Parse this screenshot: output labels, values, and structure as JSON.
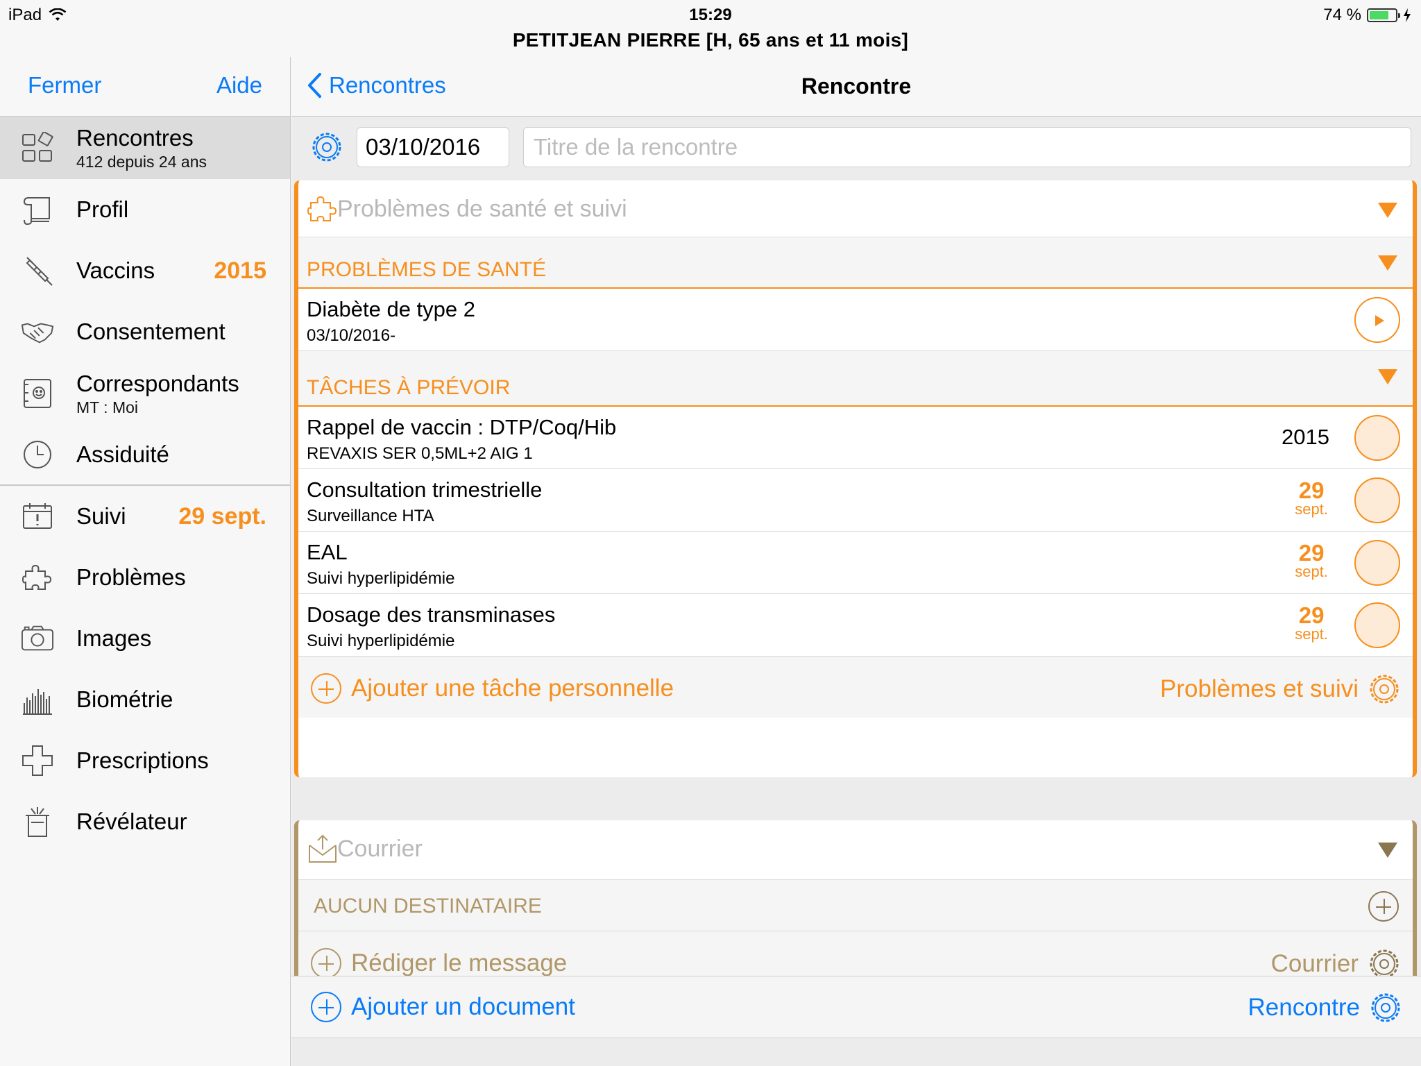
{
  "status": {
    "device": "iPad",
    "time": "15:29",
    "battery": "74 %",
    "battery_level": 0.74
  },
  "patient": "PETITJEAN PIERRE [H, 65 ans et 11 mois]",
  "sidebar": {
    "close": "Fermer",
    "help": "Aide",
    "items": [
      {
        "label": "Rencontres",
        "sub": "412 depuis 24 ans",
        "icon": "grid-icon"
      },
      {
        "label": "Profil",
        "icon": "scroll-icon"
      },
      {
        "label": "Vaccins",
        "badge": "2015",
        "icon": "syringe-icon"
      },
      {
        "label": "Consentement",
        "icon": "handshake-icon"
      },
      {
        "label": "Correspondants",
        "sub": "MT : Moi",
        "icon": "contacts-book-icon"
      },
      {
        "label": "Assiduité",
        "icon": "clock-icon"
      },
      {
        "label": "Suivi",
        "badge": "29 sept.",
        "icon": "calendar-alert-icon"
      },
      {
        "label": "Problèmes",
        "icon": "puzzle-icon"
      },
      {
        "label": "Images",
        "icon": "camera-icon"
      },
      {
        "label": "Biométrie",
        "icon": "barcode-chart-icon"
      },
      {
        "label": "Prescriptions",
        "icon": "medical-cross-icon"
      },
      {
        "label": "Révélateur",
        "icon": "magic-hat-icon"
      }
    ]
  },
  "nav": {
    "back": "Rencontres",
    "title": "Rencontre"
  },
  "encounter": {
    "date": "03/10/2016",
    "title_placeholder": "Titre de la rencontre"
  },
  "health": {
    "header": "Problèmes de santé et suivi",
    "problems_title": "PROBLÈMES DE SANTÉ",
    "problems": [
      {
        "title": "Diabète de type 2",
        "sub": "03/10/2016-"
      }
    ],
    "tasks_title": "TÂCHES À PRÉVOIR",
    "tasks": [
      {
        "title": "Rappel de vaccin : DTP/Coq/Hib",
        "sub": "REVAXIS SER 0,5ML+2 AIG 1",
        "value": "2015"
      },
      {
        "title": "Consultation trimestrielle",
        "sub": "Surveillance HTA",
        "day": "29",
        "month": "sept."
      },
      {
        "title": "EAL",
        "sub": "Suivi hyperlipidémie",
        "day": "29",
        "month": "sept."
      },
      {
        "title": "Dosage des transminases",
        "sub": "Suivi hyperlipidémie",
        "day": "29",
        "month": "sept."
      }
    ],
    "add_task": "Ajouter une tâche personnelle",
    "settings": "Problèmes et suivi"
  },
  "mail": {
    "header": "Courrier",
    "no_recipient": "AUCUN DESTINATAIRE",
    "compose": "Rédiger le message",
    "settings": "Courrier"
  },
  "document": {
    "add": "Ajouter un document",
    "settings": "Rencontre"
  },
  "colors": {
    "accent": "#0a7bf6",
    "orange": "#f68f1e",
    "brown": "#b09768"
  }
}
